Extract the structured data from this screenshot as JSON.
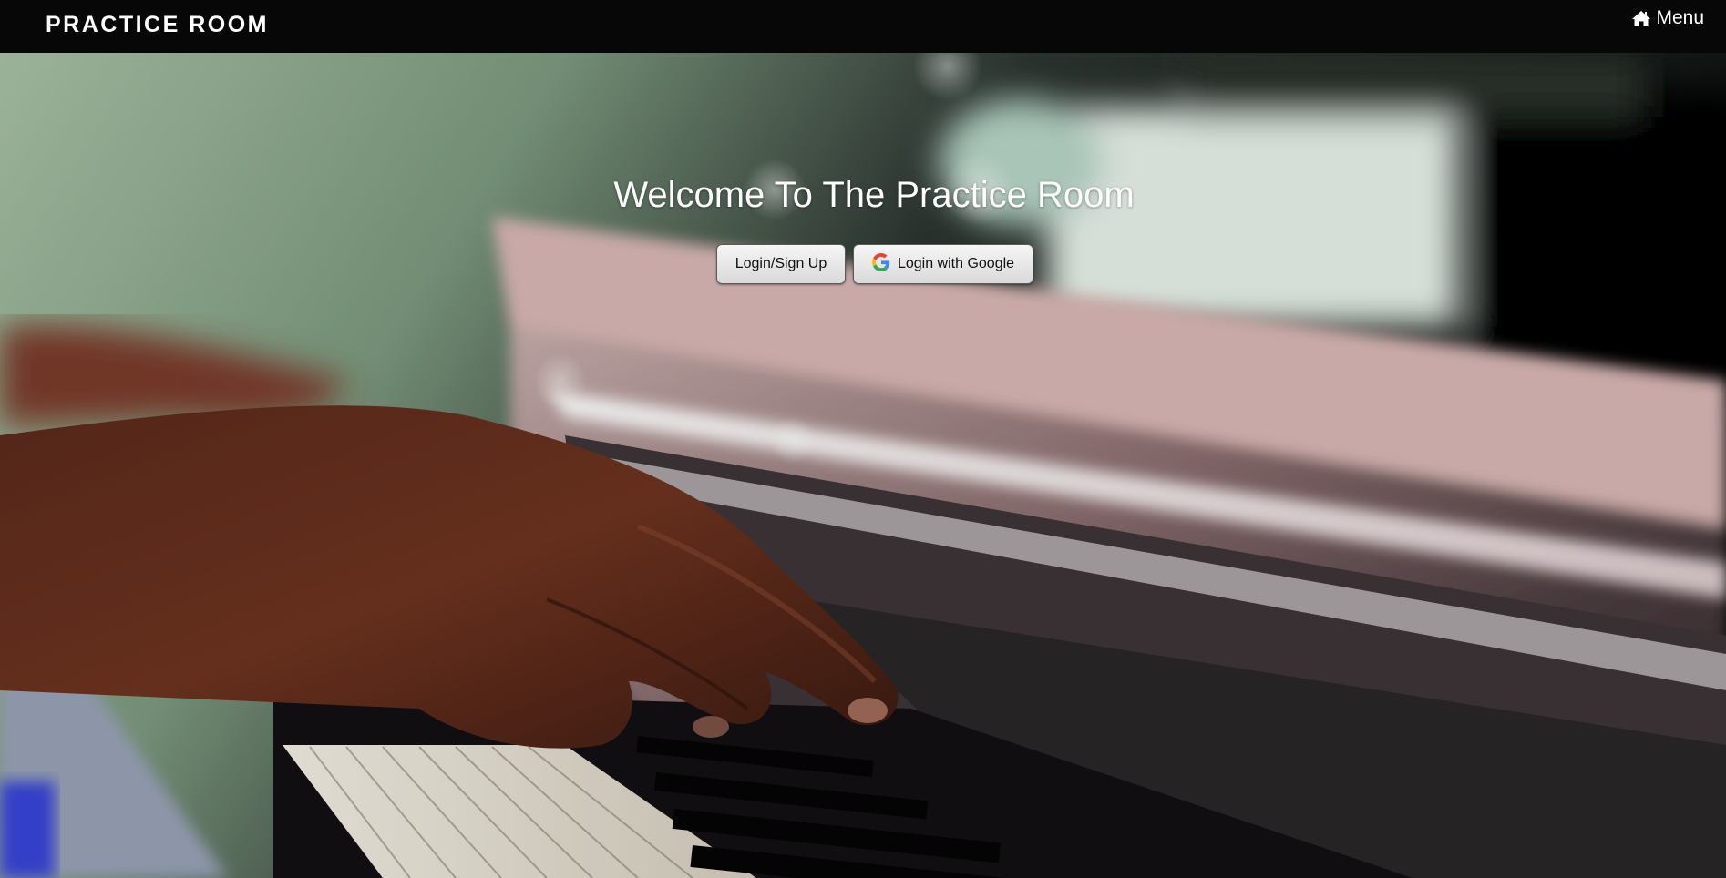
{
  "navbar": {
    "brand": "PRACTICE ROOM",
    "menu_label": "Menu",
    "menu_icon": "home-icon"
  },
  "hero": {
    "background": "piano-hands-photo",
    "title": "Welcome To The Practice Room",
    "buttons": {
      "login_label": "Login/Sign Up",
      "google_label": "Login with Google",
      "google_icon": "google-icon"
    }
  },
  "colors": {
    "navbar_bg": "#070707",
    "text": "#ffffff",
    "button_bg": "#e6e6e6",
    "google_blue": "#4285F4",
    "google_red": "#EA4335",
    "google_yellow": "#FBBC05",
    "google_green": "#34A853"
  }
}
